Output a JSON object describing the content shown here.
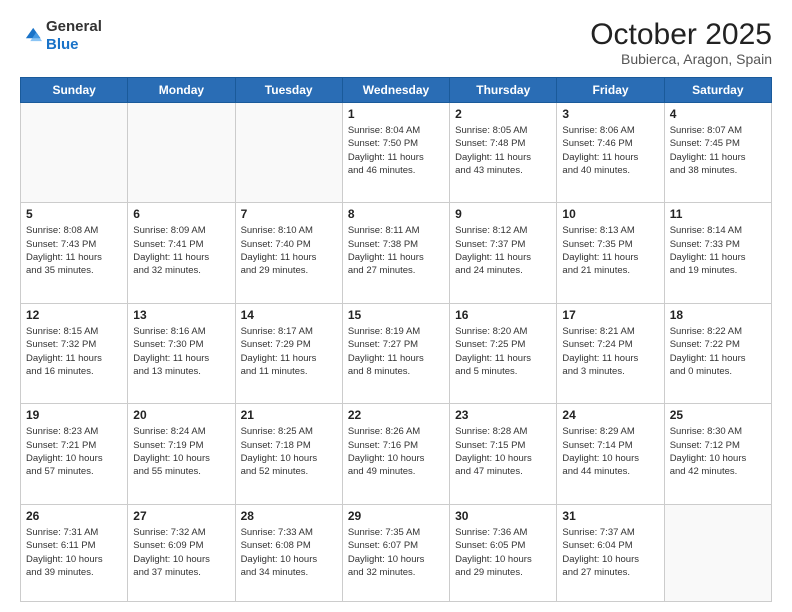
{
  "header": {
    "logo_general": "General",
    "logo_blue": "Blue",
    "month": "October 2025",
    "location": "Bubierca, Aragon, Spain"
  },
  "weekdays": [
    "Sunday",
    "Monday",
    "Tuesday",
    "Wednesday",
    "Thursday",
    "Friday",
    "Saturday"
  ],
  "weeks": [
    [
      {
        "day": "",
        "info": ""
      },
      {
        "day": "",
        "info": ""
      },
      {
        "day": "",
        "info": ""
      },
      {
        "day": "1",
        "info": "Sunrise: 8:04 AM\nSunset: 7:50 PM\nDaylight: 11 hours\nand 46 minutes."
      },
      {
        "day": "2",
        "info": "Sunrise: 8:05 AM\nSunset: 7:48 PM\nDaylight: 11 hours\nand 43 minutes."
      },
      {
        "day": "3",
        "info": "Sunrise: 8:06 AM\nSunset: 7:46 PM\nDaylight: 11 hours\nand 40 minutes."
      },
      {
        "day": "4",
        "info": "Sunrise: 8:07 AM\nSunset: 7:45 PM\nDaylight: 11 hours\nand 38 minutes."
      }
    ],
    [
      {
        "day": "5",
        "info": "Sunrise: 8:08 AM\nSunset: 7:43 PM\nDaylight: 11 hours\nand 35 minutes."
      },
      {
        "day": "6",
        "info": "Sunrise: 8:09 AM\nSunset: 7:41 PM\nDaylight: 11 hours\nand 32 minutes."
      },
      {
        "day": "7",
        "info": "Sunrise: 8:10 AM\nSunset: 7:40 PM\nDaylight: 11 hours\nand 29 minutes."
      },
      {
        "day": "8",
        "info": "Sunrise: 8:11 AM\nSunset: 7:38 PM\nDaylight: 11 hours\nand 27 minutes."
      },
      {
        "day": "9",
        "info": "Sunrise: 8:12 AM\nSunset: 7:37 PM\nDaylight: 11 hours\nand 24 minutes."
      },
      {
        "day": "10",
        "info": "Sunrise: 8:13 AM\nSunset: 7:35 PM\nDaylight: 11 hours\nand 21 minutes."
      },
      {
        "day": "11",
        "info": "Sunrise: 8:14 AM\nSunset: 7:33 PM\nDaylight: 11 hours\nand 19 minutes."
      }
    ],
    [
      {
        "day": "12",
        "info": "Sunrise: 8:15 AM\nSunset: 7:32 PM\nDaylight: 11 hours\nand 16 minutes."
      },
      {
        "day": "13",
        "info": "Sunrise: 8:16 AM\nSunset: 7:30 PM\nDaylight: 11 hours\nand 13 minutes."
      },
      {
        "day": "14",
        "info": "Sunrise: 8:17 AM\nSunset: 7:29 PM\nDaylight: 11 hours\nand 11 minutes."
      },
      {
        "day": "15",
        "info": "Sunrise: 8:19 AM\nSunset: 7:27 PM\nDaylight: 11 hours\nand 8 minutes."
      },
      {
        "day": "16",
        "info": "Sunrise: 8:20 AM\nSunset: 7:25 PM\nDaylight: 11 hours\nand 5 minutes."
      },
      {
        "day": "17",
        "info": "Sunrise: 8:21 AM\nSunset: 7:24 PM\nDaylight: 11 hours\nand 3 minutes."
      },
      {
        "day": "18",
        "info": "Sunrise: 8:22 AM\nSunset: 7:22 PM\nDaylight: 11 hours\nand 0 minutes."
      }
    ],
    [
      {
        "day": "19",
        "info": "Sunrise: 8:23 AM\nSunset: 7:21 PM\nDaylight: 10 hours\nand 57 minutes."
      },
      {
        "day": "20",
        "info": "Sunrise: 8:24 AM\nSunset: 7:19 PM\nDaylight: 10 hours\nand 55 minutes."
      },
      {
        "day": "21",
        "info": "Sunrise: 8:25 AM\nSunset: 7:18 PM\nDaylight: 10 hours\nand 52 minutes."
      },
      {
        "day": "22",
        "info": "Sunrise: 8:26 AM\nSunset: 7:16 PM\nDaylight: 10 hours\nand 49 minutes."
      },
      {
        "day": "23",
        "info": "Sunrise: 8:28 AM\nSunset: 7:15 PM\nDaylight: 10 hours\nand 47 minutes."
      },
      {
        "day": "24",
        "info": "Sunrise: 8:29 AM\nSunset: 7:14 PM\nDaylight: 10 hours\nand 44 minutes."
      },
      {
        "day": "25",
        "info": "Sunrise: 8:30 AM\nSunset: 7:12 PM\nDaylight: 10 hours\nand 42 minutes."
      }
    ],
    [
      {
        "day": "26",
        "info": "Sunrise: 7:31 AM\nSunset: 6:11 PM\nDaylight: 10 hours\nand 39 minutes."
      },
      {
        "day": "27",
        "info": "Sunrise: 7:32 AM\nSunset: 6:09 PM\nDaylight: 10 hours\nand 37 minutes."
      },
      {
        "day": "28",
        "info": "Sunrise: 7:33 AM\nSunset: 6:08 PM\nDaylight: 10 hours\nand 34 minutes."
      },
      {
        "day": "29",
        "info": "Sunrise: 7:35 AM\nSunset: 6:07 PM\nDaylight: 10 hours\nand 32 minutes."
      },
      {
        "day": "30",
        "info": "Sunrise: 7:36 AM\nSunset: 6:05 PM\nDaylight: 10 hours\nand 29 minutes."
      },
      {
        "day": "31",
        "info": "Sunrise: 7:37 AM\nSunset: 6:04 PM\nDaylight: 10 hours\nand 27 minutes."
      },
      {
        "day": "",
        "info": ""
      }
    ]
  ]
}
